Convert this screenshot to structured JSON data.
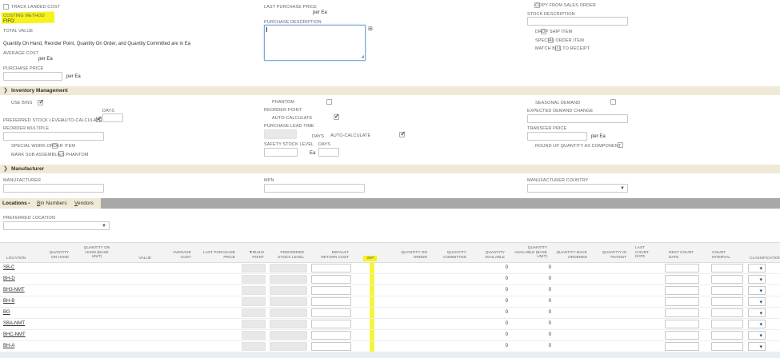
{
  "costing": {
    "track_landed_cost": "TRACK LANDED COST",
    "costing_method_label": "COSTING METHOD",
    "costing_method_value": "FIFO",
    "total_value_label": "TOTAL VALUE",
    "note": "Quantity On Hand, Reorder Point, Quantity On Order, and Quantity Committed are in Ea",
    "average_cost_label": "AVERAGE COST",
    "average_cost_unit": "per Ea",
    "purchase_price_label": "PURCHASE PRICE",
    "purchase_price_unit": "per Ea",
    "last_purchase_price_label": "LAST PURCHASE PRICE",
    "last_purchase_price_unit": "per Ea",
    "purchase_description_label": "PURCHASE DESCRIPTION",
    "copy_from_sales_order": "COPY FROM SALES ORDER",
    "stock_description_label": "STOCK DESCRIPTION",
    "drop_ship_item": "DROP SHIP ITEM",
    "special_order_item": "SPECIAL ORDER ITEM",
    "match_bill_to_receipt": "MATCH BILL TO RECEIPT"
  },
  "inventory": {
    "title": "Inventory Management",
    "use_bins": "USE BINS",
    "days_label": "DAYS",
    "preferred_stock_level_label": "PREFERRED STOCK LEVEL",
    "auto_calculate": "AUTO-CALCULATE",
    "reorder_multiple_label": "REORDER MULTIPLE",
    "special_work_order_item": "SPECIAL WORK ORDER ITEM",
    "mark_sub_assemblies_phantom": "MARK SUB ASSEMBLIES PHANTOM",
    "phantom": "PHANTOM",
    "reorder_point_label": "REORDER POINT",
    "auto_calculate_2": "AUTO-CALCULATE",
    "purchase_lead_time_label": "PURCHASE LEAD TIME",
    "days_2": "DAYS",
    "auto_calculate_3": "AUTO-CALCULATE",
    "safety_stock_level_label": "SAFETY STOCK LEVEL",
    "days_3": "DAYS",
    "safety_unit": "Ea",
    "seasonal_demand": "SEASONAL DEMAND",
    "expected_demand_change_label": "EXPECTED DEMAND CHANGE",
    "transfer_price_label": "TRANSFER PRICE",
    "transfer_price_unit": "per Ea",
    "round_up_quantity": "ROUND UP QUANTITY AS COMPONENT"
  },
  "manufacturer": {
    "title": "Manufacturer",
    "manufacturer_label": "MANUFACTURER",
    "mpn_label": "MPN",
    "country_label": "MANUFACTURER COUNTRY"
  },
  "tabs": {
    "locations": "Locations",
    "locations_marker": "•",
    "bin_numbers_first": "B",
    "bin_numbers_rest": "in Numbers",
    "vendors_first": "V",
    "vendors_rest": "endors"
  },
  "preferred_location_label": "PREFERRED LOCATION",
  "grid": {
    "headers": {
      "location": "LOCATION",
      "qty_on_hand": "QUANTITY ON HAND",
      "qty_on_hand_base": "QUANTITY ON HAND (BASE UNIT)",
      "value": "VALUE",
      "average_cost": "AVERAGE COST",
      "last_purchase_price": "LAST PURCHASE PRICE",
      "build_point": "▼BUILD POINT",
      "preferred_stock_level": "PREFERRED STOCK LEVEL",
      "default_return_cost": "DEFAULT RETURN COST",
      "wip": "WIP",
      "qty_on_order": "QUANTITY ON ORDER",
      "qty_committed": "QUANTITY COMMITTED",
      "qty_available": "QUANTITY AVAILABLE",
      "qty_available_base": "QUANTITY AVAILABLE (BASE UNIT)",
      "qty_back_ordered": "QUANTITY BACK ORDERED",
      "qty_in_transit": "QUANTITY IN TRANSIT",
      "last_count_date": "LAST COUNT DATE",
      "next_count_date": "NEXT COUNT DATE",
      "count_interval": "COUNT INTERVAL",
      "classification": "CLASSIFICATION"
    },
    "rows": [
      {
        "location": "SB-C",
        "available": "0",
        "available_base": "0"
      },
      {
        "location": "BH-D",
        "available": "0",
        "available_base": "0"
      },
      {
        "location": "BH3-NMT",
        "available": "0",
        "available_base": "0"
      },
      {
        "location": "BH-B",
        "available": "0",
        "available_base": "0"
      },
      {
        "location": "BG",
        "available": "0",
        "available_base": "0"
      },
      {
        "location": "SBA-NMT",
        "available": "0",
        "available_base": "0"
      },
      {
        "location": "BHC-NMT",
        "available": "0",
        "available_base": "0"
      },
      {
        "location": "BH-A",
        "available": "0",
        "available_base": "0"
      }
    ]
  },
  "colors": {
    "highlight": "#f5f31a",
    "section_bg": "#efe9d6",
    "tabbar_bg": "#a8a8a8"
  }
}
